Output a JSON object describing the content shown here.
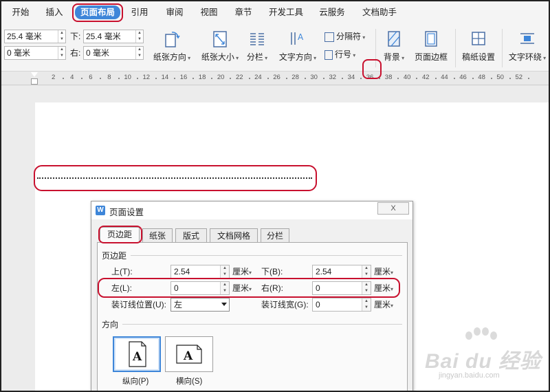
{
  "menu": {
    "tabs": [
      "开始",
      "插入",
      "页面布局",
      "引用",
      "审阅",
      "视图",
      "章节",
      "开发工具",
      "云服务",
      "文档助手"
    ],
    "active": "页面布局"
  },
  "ribbon": {
    "top_value": "25.4 毫米",
    "bottom_label": "下:",
    "bottom_value": "25.4 毫米",
    "left_value": "0 毫米",
    "right_label": "右:",
    "right_value": "0 毫米",
    "orientation_label": "纸张方向",
    "size_label": "纸张大小",
    "columns_label": "分栏",
    "text_direction_label": "文字方向",
    "breaks_label": "分隔符",
    "line_numbers_label": "行号",
    "background_label": "背景",
    "page_border_label": "页面边框",
    "manuscript_label": "稿纸设置",
    "text_wrap_label": "文字环绕"
  },
  "ruler": {
    "numbers": [
      "2",
      "4",
      "6",
      "8",
      "10",
      "12",
      "14",
      "16",
      "18",
      "20",
      "22",
      "24",
      "26",
      "28",
      "30",
      "32",
      "34",
      "36",
      "38",
      "40",
      "42",
      "44",
      "46",
      "48",
      "50",
      "52"
    ]
  },
  "dialog": {
    "title": "页面设置",
    "close": "X",
    "tabs": [
      "页边距",
      "纸张",
      "版式",
      "文档网格",
      "分栏"
    ],
    "active_tab": "页边距",
    "margins_section": "页边距",
    "top_label": "上(T):",
    "top_value": "2.54",
    "bottom_label": "下(B):",
    "bottom_value": "2.54",
    "left_label": "左(L):",
    "left_value": "0",
    "right_label": "右(R):",
    "right_value": "0",
    "unit": "厘米",
    "gutter_pos_label": "装订线位置(U):",
    "gutter_pos_value": "左",
    "gutter_width_label": "装订线宽(G):",
    "gutter_width_value": "0",
    "orientation_section": "方向",
    "portrait_label": "纵向(P)",
    "landscape_label": "横向(S)",
    "page_glyph": "A"
  },
  "watermark": {
    "main": "Bai du 经验",
    "sub": "jingyan.baidu.com"
  },
  "colors": {
    "accent": "#3e86d9",
    "highlight_ring": "#c8102e"
  }
}
